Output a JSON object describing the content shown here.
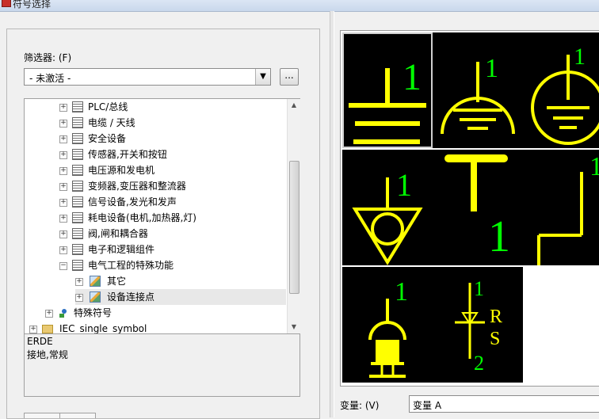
{
  "window": {
    "title": "符号选择"
  },
  "filter": {
    "label": "筛选器: (F)",
    "selected": "- 未激活 -",
    "more_button": "..."
  },
  "tree": {
    "items": [
      {
        "label": "PLC/总线",
        "expander": "+",
        "icon": "cabinet-icon",
        "level": 1
      },
      {
        "label": "电缆 / 天线",
        "expander": "+",
        "icon": "cabinet-icon",
        "level": 1
      },
      {
        "label": "安全设备",
        "expander": "+",
        "icon": "cabinet-icon",
        "level": 1
      },
      {
        "label": "传感器,开关和按钮",
        "expander": "+",
        "icon": "cabinet-icon",
        "level": 1
      },
      {
        "label": "电压源和发电机",
        "expander": "+",
        "icon": "cabinet-icon",
        "level": 1
      },
      {
        "label": "变频器,变压器和整流器",
        "expander": "+",
        "icon": "cabinet-icon",
        "level": 1
      },
      {
        "label": "信号设备,发光和发声",
        "expander": "+",
        "icon": "cabinet-icon",
        "level": 1
      },
      {
        "label": "耗电设备(电机,加热器,灯)",
        "expander": "+",
        "icon": "cabinet-icon",
        "level": 1
      },
      {
        "label": "阀,闸和耦合器",
        "expander": "+",
        "icon": "cabinet-icon",
        "level": 1
      },
      {
        "label": "电子和逻辑组件",
        "expander": "+",
        "icon": "cabinet-icon",
        "level": 1
      },
      {
        "label": "电气工程的特殊功能",
        "expander": "−",
        "icon": "cabinet-icon",
        "level": 1
      },
      {
        "label": "其它",
        "expander": "+",
        "icon": "image-icon",
        "level": 2
      },
      {
        "label": "设备连接点",
        "expander": "+",
        "icon": "image-icon",
        "level": 2,
        "selected": true
      },
      {
        "label": "特殊符号",
        "expander": "+",
        "icon": "special-symbol-icon",
        "level": 0
      },
      {
        "label": "IEC_single_symbol",
        "expander": "+",
        "icon": "folder-icon",
        "level": -1
      }
    ]
  },
  "description": {
    "line1": "ERDE",
    "line2": "接地,常规"
  },
  "gallery": {
    "symbols": [
      {
        "name": "ground-symbol",
        "label": "1",
        "selected": true
      },
      {
        "name": "ground-semicircle-symbol",
        "label": "1"
      },
      {
        "name": "ground-circle-symbol",
        "label": "1"
      },
      {
        "name": "ground-triangle-symbol",
        "label": "1"
      },
      {
        "name": "t-terminal-symbol",
        "label": "1"
      },
      {
        "name": "corner-terminal-symbol",
        "label": "1"
      },
      {
        "name": "plug-connector-symbol",
        "label": "1"
      },
      {
        "name": "rs-connection-symbol",
        "label_top": "1",
        "label_r": "R",
        "label_s": "S",
        "label_bottom": "2"
      }
    ]
  },
  "variant": {
    "label": "变量: (V)",
    "selected": "变量 A"
  },
  "colors": {
    "symbol_yellow": "#ffff00",
    "label_green": "#00ff00",
    "cell_bg": "#000000"
  }
}
